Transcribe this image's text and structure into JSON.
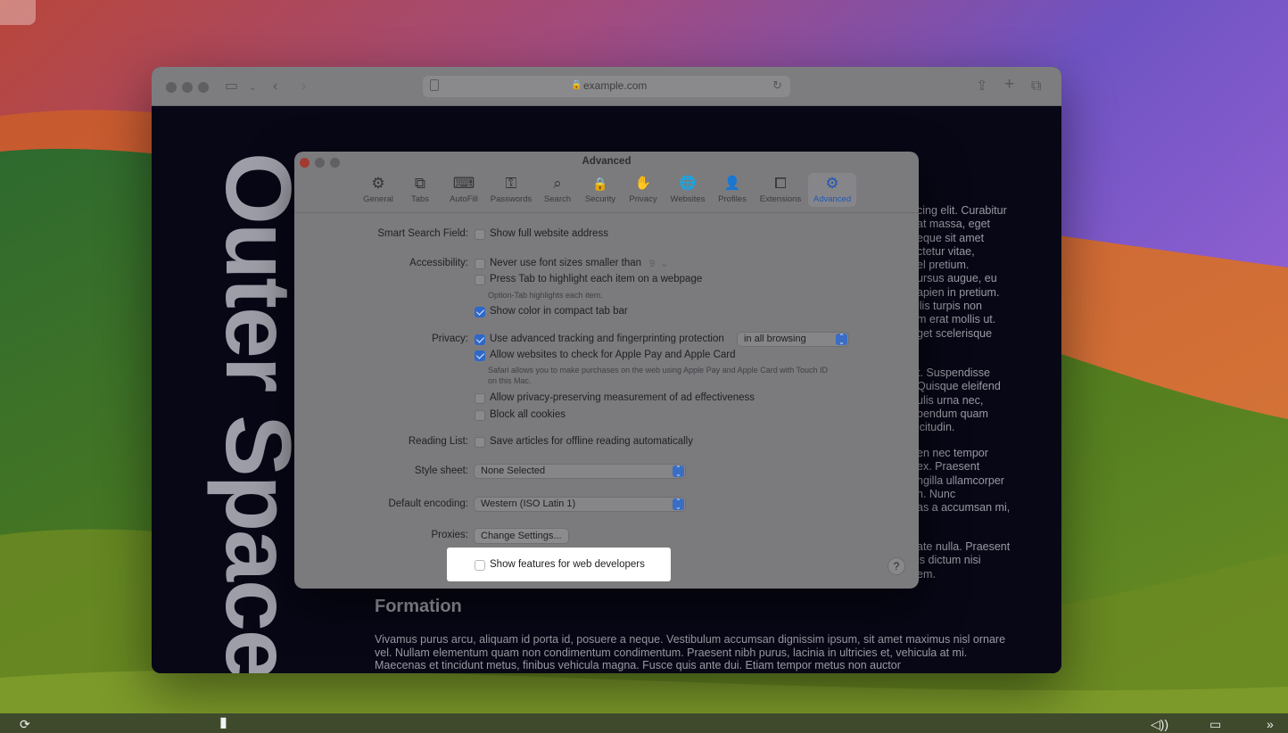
{
  "browser": {
    "url": "example.com"
  },
  "webpage": {
    "vertical_title": "Outer Space",
    "side_paragraphs": [
      "cing elit. Curabitur\nat massa, eget\neque sit amet\nctetur vitae,\nel pretium.\nursus augue, eu\napien in pretium.\nllis turpis non\nm erat mollis ut.\nget scelerisque",
      "t. Suspendisse\nQuisque eleifend\nulis urna nec,\nbendum quam\nicitudin.",
      "en nec tempor\nex. Praesent\nngilla ullamcorper\nn. Nunc\nas a accumsan mi,",
      "ate nulla. Praesent\nis dictum nisi\nem."
    ],
    "formation_heading": "Formation",
    "formation_body": "Vivamus purus arcu, aliquam id porta id, posuere a neque. Vestibulum accumsan dignissim ipsum, sit amet maximus nisl ornare vel. Nullam elementum quam non condimentum condimentum. Praesent nibh purus, lacinia in ultricies et, vehicula at mi. Maecenas et tincidunt metus, finibus vehicula magna. Fusce quis ante dui. Etiam tempor metus non auctor"
  },
  "settings": {
    "title": "Advanced",
    "tabs": [
      {
        "label": "General",
        "icon": "⚙"
      },
      {
        "label": "Tabs",
        "icon": "⧉"
      },
      {
        "label": "AutoFill",
        "icon": "⌨"
      },
      {
        "label": "Passwords",
        "icon": "⚿"
      },
      {
        "label": "Search",
        "icon": "⌕"
      },
      {
        "label": "Security",
        "icon": "🔒"
      },
      {
        "label": "Privacy",
        "icon": "✋"
      },
      {
        "label": "Websites",
        "icon": "🌐"
      },
      {
        "label": "Profiles",
        "icon": "👤"
      },
      {
        "label": "Extensions",
        "icon": "⧠"
      },
      {
        "label": "Advanced",
        "icon": "⚙"
      }
    ],
    "smart_search": {
      "label": "Smart Search Field:",
      "show_full_address": "Show full website address"
    },
    "accessibility": {
      "label": "Accessibility:",
      "min_font": "Never use font sizes smaller than",
      "min_font_value": "9",
      "press_tab": "Press Tab to highlight each item on a webpage",
      "press_tab_hint": "Option-Tab highlights each item.",
      "show_color": "Show color in compact tab bar"
    },
    "privacy": {
      "label": "Privacy:",
      "advanced_tracking": "Use advanced tracking and fingerprinting protection",
      "tracking_scope": "in all browsing",
      "apple_pay": "Allow websites to check for Apple Pay and Apple Card",
      "apple_pay_hint": "Safari allows you to make purchases on the web using Apple Pay and Apple Card with Touch ID on this Mac.",
      "ad_measurement": "Allow privacy-preserving measurement of ad effectiveness",
      "block_cookies": "Block all cookies"
    },
    "reading_list": {
      "label": "Reading List:",
      "save_offline": "Save articles for offline reading automatically"
    },
    "style_sheet": {
      "label": "Style sheet:",
      "value": "None Selected"
    },
    "encoding": {
      "label": "Default encoding:",
      "value": "Western (ISO Latin 1)"
    },
    "proxies": {
      "label": "Proxies:",
      "button": "Change Settings..."
    },
    "web_developers": "Show features for web developers",
    "help": "?"
  }
}
